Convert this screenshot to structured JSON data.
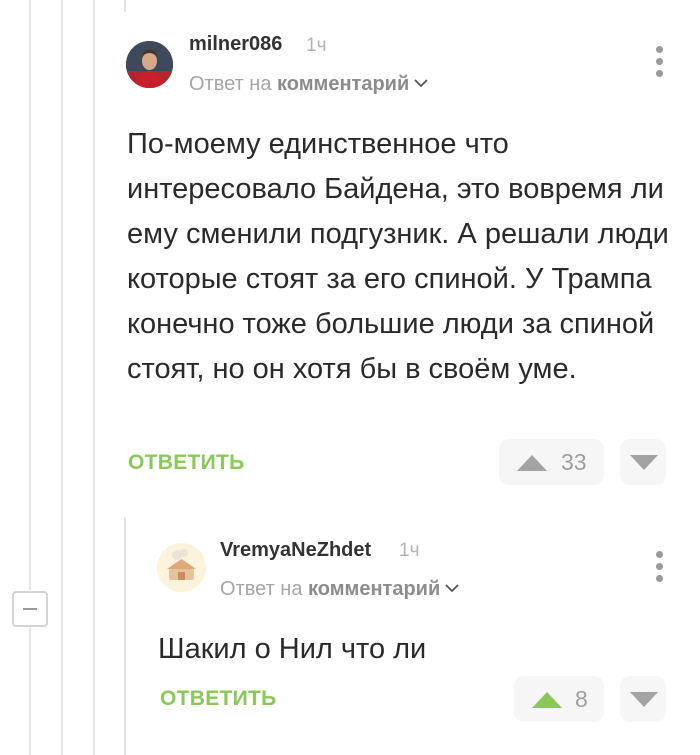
{
  "comments": [
    {
      "username": "milner086",
      "time": "1ч",
      "reply_prefix": "Ответ на",
      "reply_target": "комментарий",
      "text": "По-моему единственное что интересовало Байдена, это вовремя ли ему сменили подгузник. А решали люди которые стоят за его спиной. У Трампа конечно тоже большие люди за спиной стоят, но он хотя бы в своём уме.",
      "reply_label": "ОТВЕТИТЬ",
      "rating": "33",
      "upvoted": false
    },
    {
      "username": "VremyaNeZhdet",
      "time": "1ч",
      "reply_prefix": "Ответ на",
      "reply_target": "комментарий",
      "text": "Шакил о Нил что ли",
      "reply_label": "ОТВЕТИТЬ",
      "rating": "8",
      "upvoted": true
    }
  ],
  "colors": {
    "accent": "#8ac858",
    "vote_active": "#8ac858",
    "vote_inactive": "#a3a3a3"
  }
}
